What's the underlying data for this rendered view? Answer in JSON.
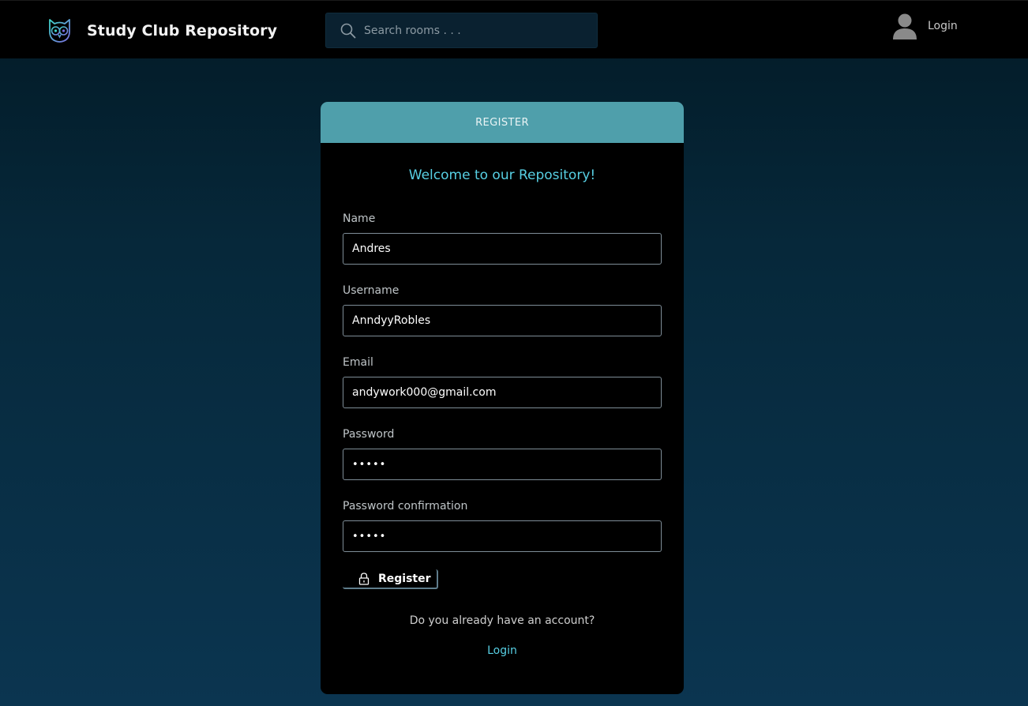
{
  "header": {
    "app_title": "Study Club Repository",
    "logo_icon": "owl-logo-icon",
    "search": {
      "placeholder": "Search rooms . . .",
      "value": "",
      "icon": "search-icon"
    },
    "user": {
      "avatar_icon": "user-avatar-icon",
      "login_label": "Login"
    }
  },
  "card": {
    "header_label": "REGISTER",
    "welcome": "Welcome to our Repository!",
    "fields": [
      {
        "label": "Name",
        "value": "Andres"
      },
      {
        "label": "Username",
        "value": "AnndyyRobles"
      },
      {
        "label": "Email",
        "value": "andywork000@gmail.com"
      },
      {
        "label": "Password",
        "value": "•••••"
      },
      {
        "label": "Password confirmation",
        "value": "•••••"
      }
    ],
    "register_button": {
      "label": "Register",
      "icon": "lock-icon"
    },
    "already_text": "Do you already have an account?",
    "login_link": "Login"
  },
  "colors": {
    "header_bg": "#000000",
    "card_header_bg": "#4f9fab",
    "accent": "#57cfe3",
    "page_gradient_top": "#031a26",
    "page_gradient_bottom": "#0b3550"
  }
}
